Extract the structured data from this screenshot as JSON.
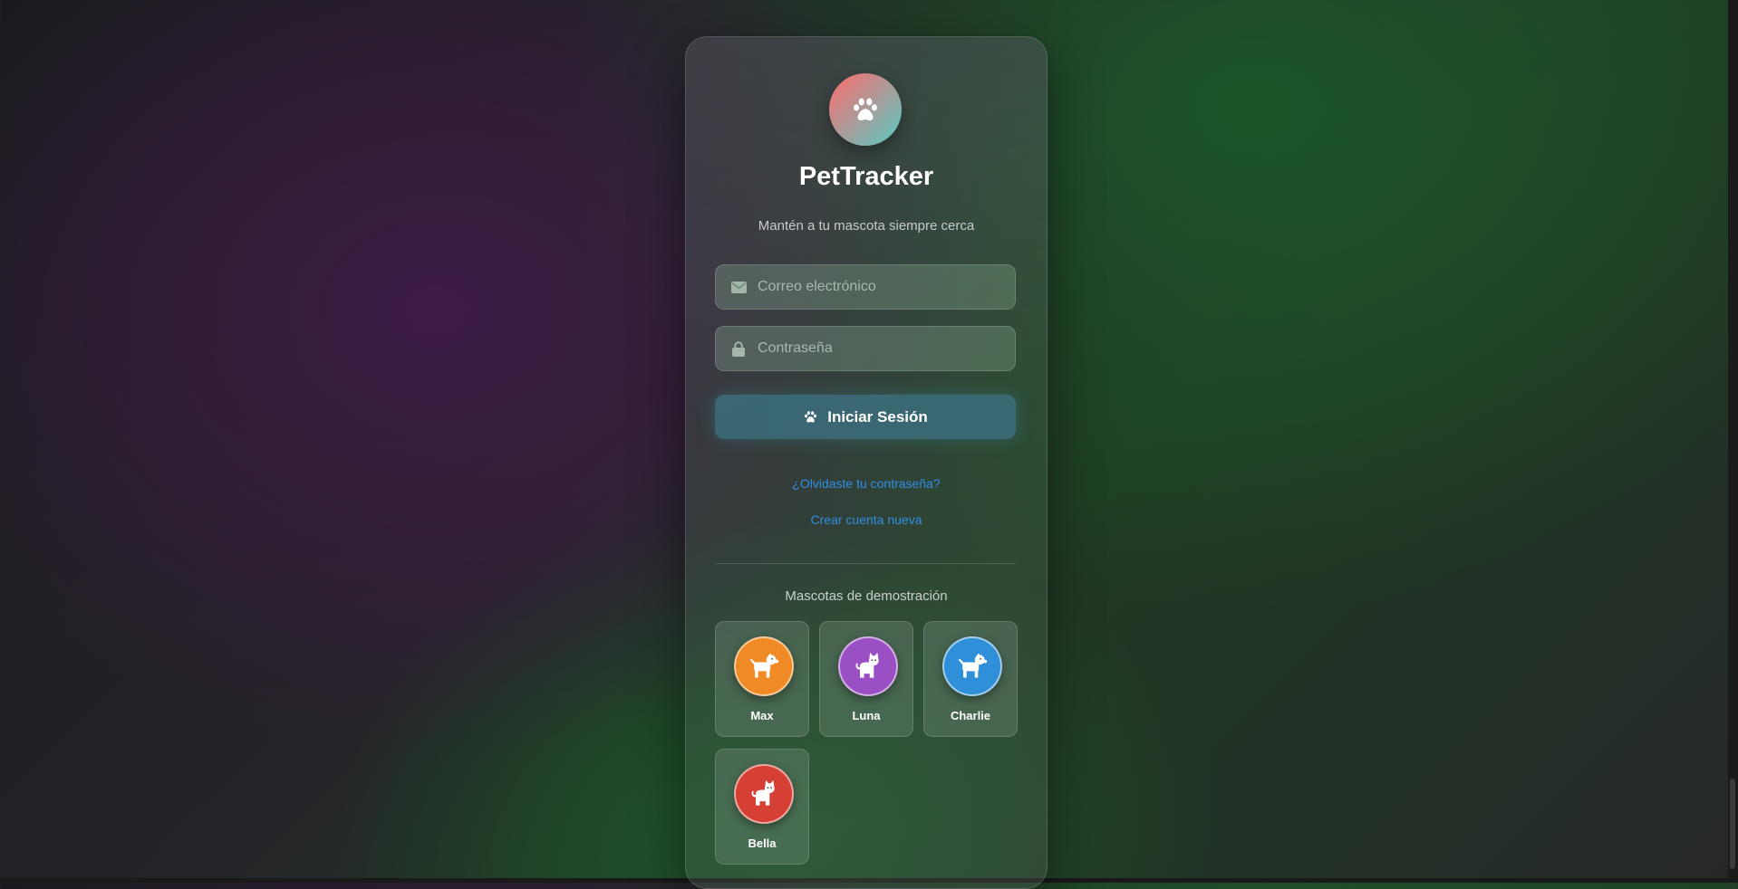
{
  "app": {
    "title": "PetTracker",
    "subtitle": "Mantén a tu mascota siempre cerca",
    "logo_icon": "paw-icon"
  },
  "login_form": {
    "email": {
      "placeholder": "Correo electrónico",
      "value": "",
      "icon": "envelope-icon"
    },
    "password": {
      "placeholder": "Contraseña",
      "value": "",
      "icon": "lock-icon"
    },
    "submit_label": "Iniciar Sesión",
    "submit_icon": "paw-icon"
  },
  "links": {
    "forgot_password": "¿Olvidaste tu contraseña?",
    "create_account": "Crear cuenta nueva"
  },
  "demo_pets": {
    "title": "Mascotas de demostración",
    "pets": [
      {
        "name": "Max",
        "kind": "dog",
        "icon": "dog-icon",
        "color": "#f08a24"
      },
      {
        "name": "Luna",
        "kind": "cat",
        "icon": "cat-icon",
        "color": "#9b4fc4"
      },
      {
        "name": "Charlie",
        "kind": "dog",
        "icon": "dog-icon",
        "color": "#2f8fd8"
      },
      {
        "name": "Bella",
        "kind": "cat",
        "icon": "cat-icon",
        "color": "#d63f33"
      }
    ]
  },
  "colors": {
    "accent_link": "#2f8fe3",
    "button": "#3c7080",
    "logo_gradient_start": "#ef7474",
    "logo_gradient_end": "#5fc6c0"
  }
}
